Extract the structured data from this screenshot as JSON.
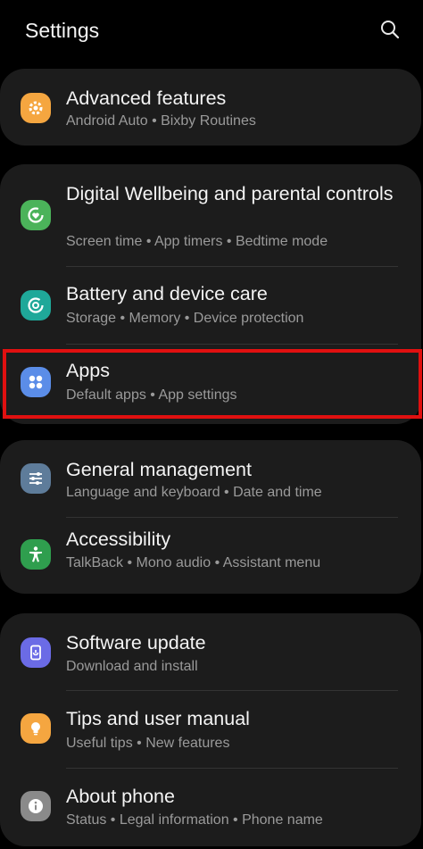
{
  "header": {
    "title": "Settings",
    "search_icon": "search-icon"
  },
  "colors": {
    "background": "#000000",
    "card": "#1c1c1c",
    "highlight": "#e01010"
  },
  "cards": [
    {
      "items": [
        {
          "title": "Advanced features",
          "subtitle": "Android Auto  •  Bixby Routines",
          "icon": "gear-icon",
          "icon_color": "#f5a640"
        }
      ]
    },
    {
      "items": [
        {
          "title": "Digital Wellbeing and parental controls",
          "subtitle": "Screen time  •  App timers  •  Bedtime mode",
          "icon": "wellbeing-icon",
          "icon_color": "#4bb35a"
        },
        {
          "title": "Battery and device care",
          "subtitle": "Storage  •  Memory  •  Device protection",
          "icon": "device-care-icon",
          "icon_color": "#1fa899"
        },
        {
          "title": "Apps",
          "subtitle": "Default apps  •  App settings",
          "icon": "apps-icon",
          "icon_color": "#5b8de8"
        }
      ]
    },
    {
      "items": [
        {
          "title": "General management",
          "subtitle": "Language and keyboard  •  Date and time",
          "icon": "sliders-icon",
          "icon_color": "#5e7c9a"
        },
        {
          "title": "Accessibility",
          "subtitle": "TalkBack  •  Mono audio  •  Assistant menu",
          "icon": "accessibility-icon",
          "icon_color": "#2f9e4e"
        }
      ]
    },
    {
      "items": [
        {
          "title": "Software update",
          "subtitle": "Download and install",
          "icon": "software-update-icon",
          "icon_color": "#6b6be6"
        },
        {
          "title": "Tips and user manual",
          "subtitle": "Useful tips  •  New features",
          "icon": "lightbulb-icon",
          "icon_color": "#f5a640"
        },
        {
          "title": "About phone",
          "subtitle": "Status  •  Legal information  •  Phone name",
          "icon": "info-icon",
          "icon_color": "#8a8a8a"
        }
      ]
    }
  ]
}
